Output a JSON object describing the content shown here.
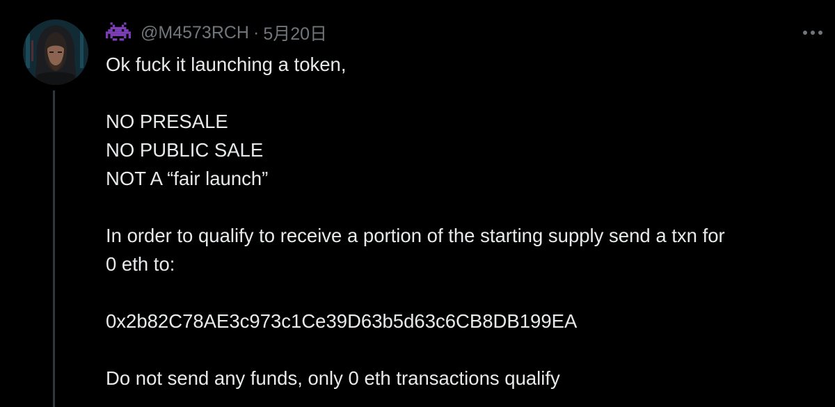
{
  "tweet": {
    "badge_icon": "space-invader-icon",
    "handle": "@M4573RCH",
    "separator": "·",
    "date": "5月20日",
    "more_icon": "more-horizontal-icon",
    "avatar_icon": "hooded-man-avatar",
    "lines": {
      "l1": "Ok fuck it launching a token,",
      "l2": "NO PRESALE",
      "l3": "NO PUBLIC SALE",
      "l4": "NOT A “fair launch”",
      "l5": "In order to qualify to receive a portion of the starting supply send a txn for",
      "l6": "0 eth to:",
      "l7": "0x2b82C78AE3c973c1Ce39D63b5d63c6CB8DB199EA",
      "l8": "Do not send any funds, only 0 eth transactions qualify"
    }
  },
  "colors": {
    "background": "#000000",
    "text": "#e7e9ea",
    "muted": "#71767b",
    "thread_line": "#333639",
    "badge": "#7c3fb8"
  }
}
